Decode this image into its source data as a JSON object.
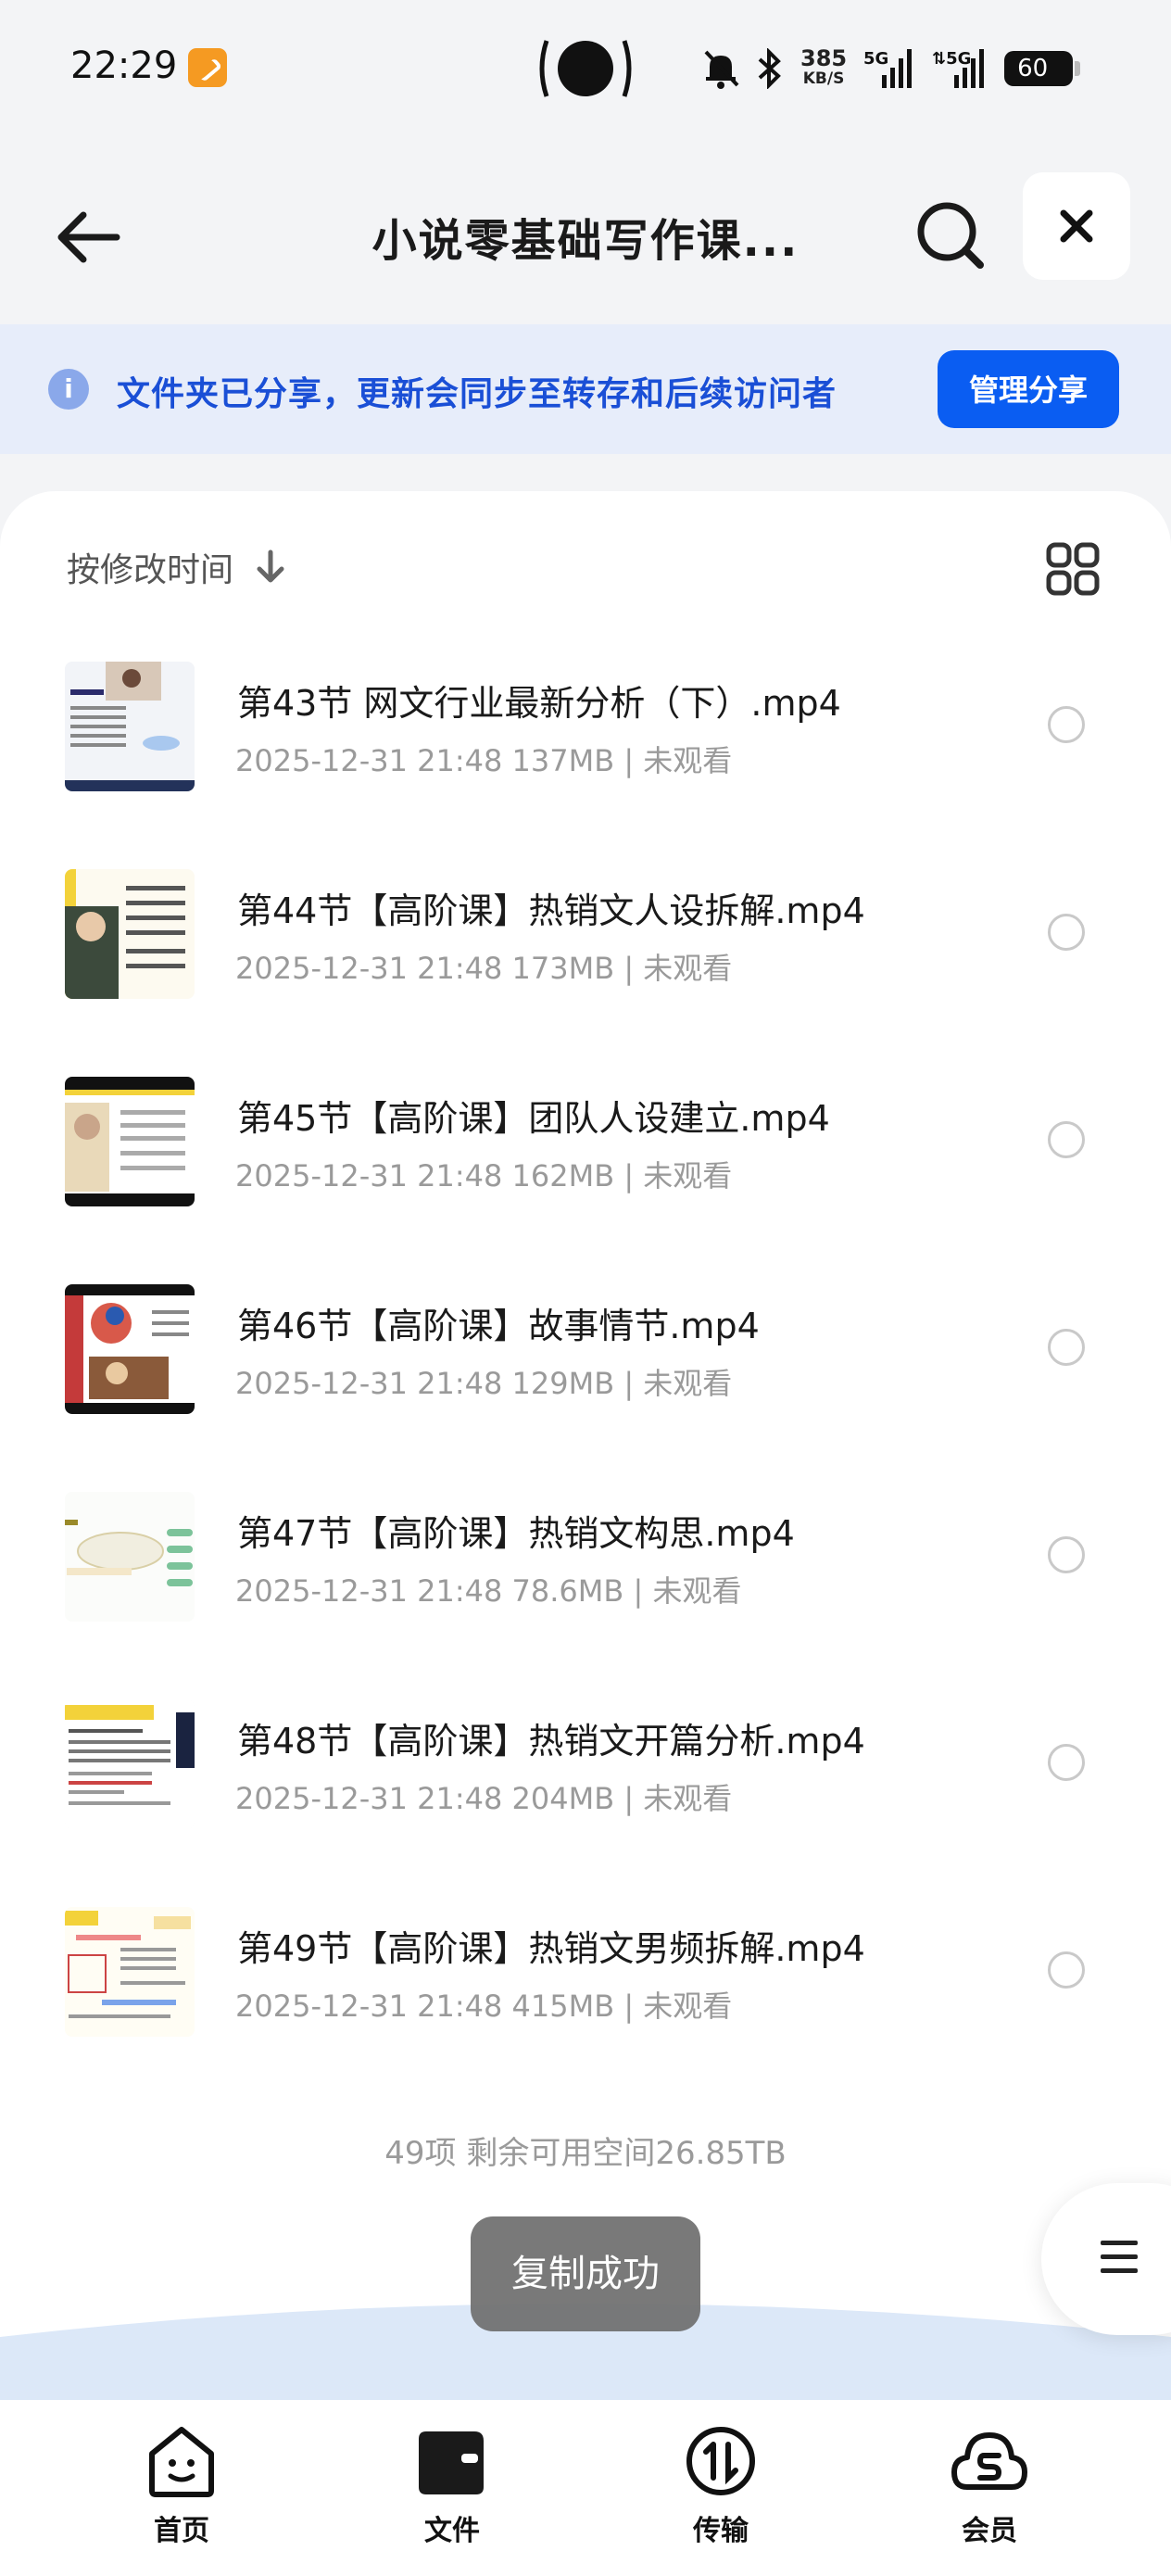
{
  "status_bar": {
    "time": "22:29",
    "net_speed": "385",
    "net_unit": "KB/S",
    "net1": "5G",
    "net2": "5G",
    "battery": "60"
  },
  "nav": {
    "title": "小说零基础写作课...",
    "back_icon": "arrow-left-icon",
    "search_icon": "search-icon",
    "close_icon": "close-icon"
  },
  "banner": {
    "text": "文件夹已分享，更新会同步至转存和后续访问者",
    "button": "管理分享"
  },
  "sort": {
    "label": "按修改时间",
    "direction_icon": "arrow-down-icon"
  },
  "files": [
    {
      "name": "第43节 网文行业最新分析（下）.mp4",
      "meta": "2025-12-31 21:48  137MB | 未观看"
    },
    {
      "name": "第44节【高阶课】热销文人设拆解.mp4",
      "meta": "2025-12-31 21:48  173MB | 未观看"
    },
    {
      "name": "第45节【高阶课】团队人设建立.mp4",
      "meta": "2025-12-31 21:48  162MB | 未观看"
    },
    {
      "name": "第46节【高阶课】故事情节.mp4",
      "meta": "2025-12-31 21:48  129MB | 未观看"
    },
    {
      "name": "第47节【高阶课】热销文构思.mp4",
      "meta": "2025-12-31 21:48  78.6MB | 未观看"
    },
    {
      "name": "第48节【高阶课】热销文开篇分析.mp4",
      "meta": "2025-12-31 21:48  204MB | 未观看"
    },
    {
      "name": "第49节【高阶课】热销文男频拆解.mp4",
      "meta": "2025-12-31 21:48  415MB | 未观看"
    }
  ],
  "footer": {
    "count": "49项  剩余可用空间26.85TB"
  },
  "toast": "复制成功",
  "tabs": [
    {
      "label": "首页",
      "icon": "home-smile-icon"
    },
    {
      "label": "文件",
      "icon": "folder-icon"
    },
    {
      "label": "传输",
      "icon": "transfer-icon"
    },
    {
      "label": "会员",
      "icon": "vip-cloud-icon"
    }
  ],
  "colors": {
    "accent": "#0a5df2",
    "banner_bg": "#e7edfa",
    "banner_text": "#1a4fd6"
  }
}
